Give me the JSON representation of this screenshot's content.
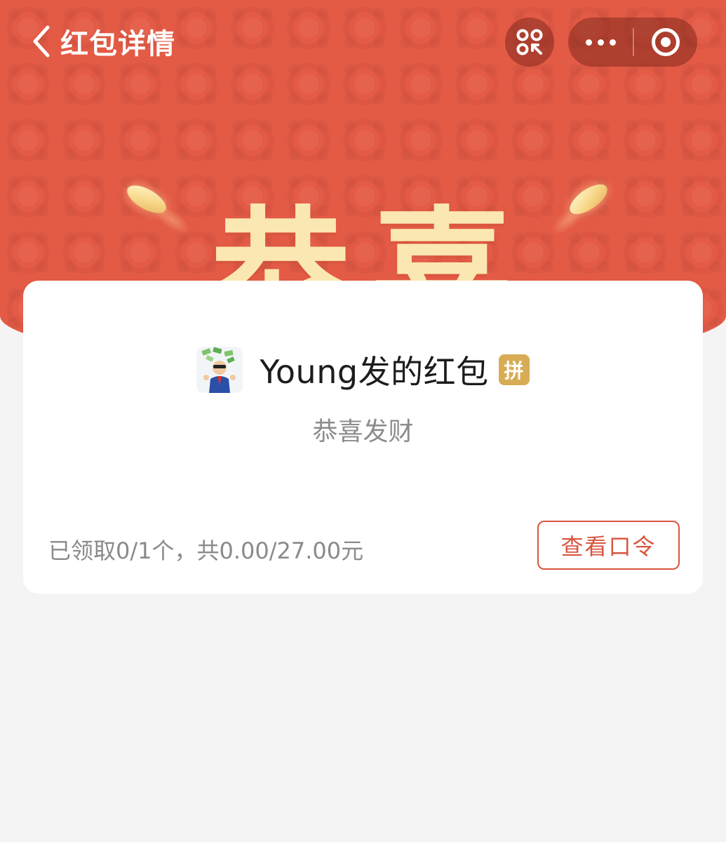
{
  "header": {
    "title": "红包详情",
    "big_text_1": "恭",
    "big_text_2": "喜",
    "accent_color": "#e35a45"
  },
  "nav_icons": {
    "back": "chevron-left-icon",
    "scan": "scan-icon",
    "more": "more-dots-icon",
    "close": "target-circle-icon"
  },
  "card": {
    "sender_name": "Young发的红包",
    "badge": "拼",
    "blessing": "恭喜发财",
    "summary": "已领取0/1个，共0.00/27.00元",
    "button_label": "查看口令",
    "button_color": "#d9553f",
    "badge_color": "#d7ac55"
  }
}
